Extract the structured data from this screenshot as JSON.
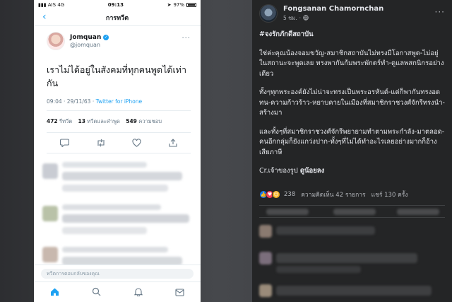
{
  "phone": {
    "status": {
      "carrier": "AIS",
      "network": "4G",
      "time": "09:13",
      "battery": "97%"
    },
    "nav": {
      "title": "การทวีต"
    },
    "tweet": {
      "display_name": "Jomquan",
      "handle": "@jomquan",
      "text": "เราไม่ได้อยู่ในสังคมที่ทุกคนพูดได้เท่ากัน",
      "time": "09:04 · 29/11/63 · ",
      "source": "Twitter for iPhone",
      "retweets": "472",
      "retweets_label": "รีทวีต",
      "quotes": "13",
      "quotes_label": "ทวีตและคำพูด",
      "likes": "549",
      "likes_label": "ความชอบ"
    },
    "reply_placeholder": "ทวีตการตอบกลับของคุณ"
  },
  "facebook": {
    "name": "Fongsanan Chamornchan",
    "time": "5 ชม.",
    "hashtag": "#จงรักภักดีสถาบัน",
    "para1": "ใช่ค่ะคุณน้องจอมขวัญ-สมาชิกสถาบันไม่ทรงมีโอกาสพูด-ไม่อยู่ในสถานะจะพูดเลย ทรงพากันก้มพระพักตร์ทำ-ดูแลพสกนิกรอย่างเดียว",
    "para2": "ทั้งๆทุกพระองค์ยังไม่น่าจะทรงเป็นพระอรหันต์-แต่ก็พากันทรงอดทน-ความก้าวร้าว-หยาบคายในเมืองที่สมาชิกราชวงศ์จักรีทรงนำ-สร้างมา",
    "para3": "และทั้งๆที่สมาชิกราชวงศ์จักรีพยายามทำตามพระกำลัง-มาตลอด-คนอีกกลุ่มก็ยังแกว่งปาก-ทั้งๆที่ไม่ได้ทำอะไรเลยอย่างมากก็อ้างเสียภาษี",
    "credit_prefix": "Cr.เจ้าของรูป ",
    "credit_name": "ดูน้อยลง",
    "reactions": "238",
    "comments": "ความคิดเห็น 42 รายการ",
    "shares": "แชร์ 130 ครั้ง"
  },
  "colors": {
    "twitter_blue": "#1da1f2",
    "fb_bg": "#242526",
    "fb_text": "#e4e6eb",
    "like_blue": "#1877f2",
    "love_red": "#f33e58",
    "haha_yellow": "#f7b125"
  },
  "icons": [
    "back-chevron-icon",
    "verified-badge-icon",
    "more-icon",
    "reply-icon",
    "retweet-icon",
    "like-icon",
    "share-icon",
    "home-icon",
    "search-icon",
    "notifications-icon",
    "messages-icon",
    "globe-icon",
    "like-reaction-icon",
    "love-reaction-icon",
    "haha-reaction-icon"
  ]
}
